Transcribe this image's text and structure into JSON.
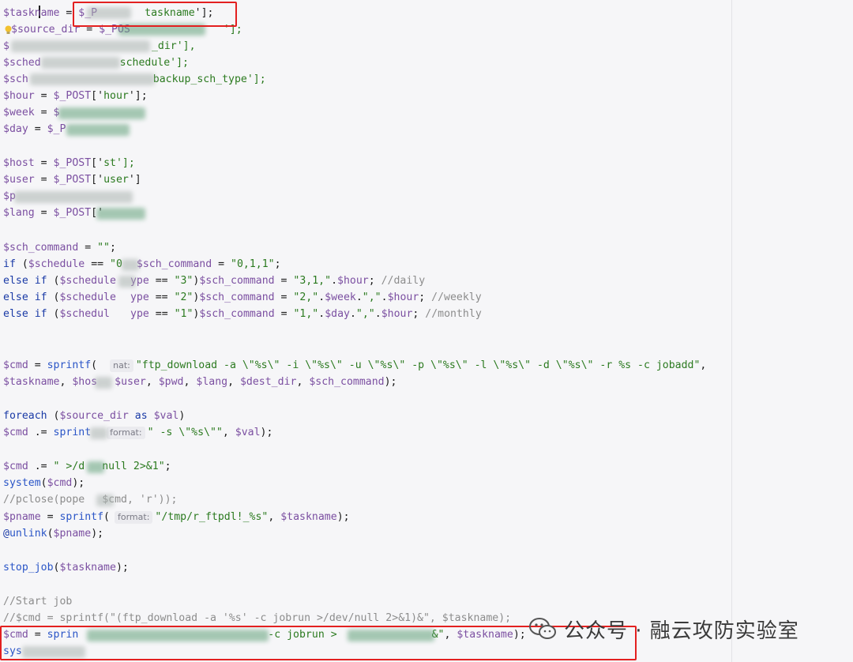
{
  "code": {
    "l1": [
      "$taskname",
      " = ",
      "$_P",
      "taskname",
      "'];"
    ],
    "l2": [
      "$source_dir",
      " = ",
      "$_POS",
      "'];"
    ],
    "l3": [
      "$",
      "_dir'],"
    ],
    "l4": [
      "$sched",
      "schedule'];"
    ],
    "l5": [
      "$sch",
      "backup_sch_type'];"
    ],
    "l6": [
      "$hour",
      " = ",
      "$_POST",
      "['",
      "hour",
      "'];"
    ],
    "l7": [
      "$week",
      " = ",
      "$"
    ],
    "l8": [
      "$day",
      " = ",
      "$_P"
    ],
    "l9": [
      "$host",
      " = ",
      "$_POST",
      "['",
      "st'];"
    ],
    "l10": [
      "$user",
      " = ",
      "$_POST",
      "['",
      "user",
      "']"
    ],
    "l11": [
      "$p"
    ],
    "l12": [
      "$lang",
      " = ",
      "$_POST",
      "['"
    ],
    "l13": [
      "$sch_command",
      " = ",
      "\"\"",
      ";"
    ],
    "l14": [
      "if",
      " (",
      "$schedule",
      " == ",
      "\"0",
      "$sch_command",
      " = ",
      "\"0,1,1\"",
      ";"
    ],
    "l15": [
      "else if",
      " (",
      "$schedule",
      "ype",
      " == ",
      "\"3\"",
      ")",
      "$sch_command",
      " = ",
      "\"3,1,\"",
      ".",
      "$hour",
      "; ",
      "//daily"
    ],
    "l16": [
      "else if",
      " (",
      "$schedule",
      "ype",
      " == ",
      "\"2\"",
      ")",
      "$sch_command",
      " = ",
      "\"2,\"",
      ".",
      "$week",
      ".",
      "\",\"",
      ".",
      "$hour",
      "; ",
      "//weekly"
    ],
    "l17": [
      "else if",
      " (",
      "$schedul",
      "ype",
      " == ",
      "\"1\"",
      ")",
      "$sch_command",
      " = ",
      "\"1,\"",
      ".",
      "$day",
      ".",
      "\",\"",
      ".",
      "$hour",
      "; ",
      "//monthly"
    ],
    "l18": [
      "$cmd",
      " = ",
      "sprintf",
      "(",
      "nat:",
      "\"ftp_download -a \\\"%s\\\" -i \\\"%s\\\" -u \\\"%s\\\" -p \\\"%s\\\" -l \\\"%s\\\" -d \\\"%s\\\" -r %s -c jobadd\"",
      ","
    ],
    "l19": [
      "$taskname",
      ", ",
      "$hos",
      "$user",
      ", ",
      "$pwd",
      ", ",
      "$lang",
      ", ",
      "$dest_dir",
      ", ",
      "$sch_command",
      ");"
    ],
    "l20": [
      "foreach",
      " (",
      "$source_dir",
      " as ",
      "$val",
      ")"
    ],
    "l21": [
      "$cmd",
      " .= ",
      "sprint",
      "format:",
      "\" -s \\\"%s\\\"\"",
      ", ",
      "$val",
      ");"
    ],
    "l22": [
      "$cmd",
      " .= ",
      "\" >/d",
      "null 2>&1\"",
      ";"
    ],
    "l23": [
      "system",
      "(",
      "$cmd",
      ");"
    ],
    "l24": [
      "//pclose(pope",
      "$cmd, 'r'));"
    ],
    "l25": [
      "$pname",
      " = ",
      "sprintf",
      "(",
      "format:",
      "\"/tmp/r_ftpdl!_%s\"",
      ", ",
      "$taskname",
      ");"
    ],
    "l26": [
      "@",
      "unlink",
      "(",
      "$pname",
      ");"
    ],
    "l27": [
      "stop_job",
      "(",
      "$taskname",
      ");"
    ],
    "l28": [
      "//Start job"
    ],
    "l29": [
      "//$cmd = sprintf(\"(ftp_download -a '%s' -c jobrun >/dev/null 2>&1)&\", $taskname);"
    ],
    "l30": [
      "$cmd",
      " = ",
      "sprin",
      "-c jobrun >",
      " &\"",
      ", ",
      "$taskname",
      ");"
    ],
    "l31": [
      "sys"
    ]
  },
  "watermark": {
    "text": "公众号 · 融云攻防实验室"
  },
  "colors": {
    "variable": "#7b4fa1",
    "string": "#2b7a1f",
    "function": "#2a55c7",
    "keyword": "#1a3aa6",
    "comment": "#8c8c8c",
    "highlight_box": "#e32020",
    "background": "#f6f6f8"
  },
  "icons": [
    "lightbulb-icon",
    "wechat-logo-icon"
  ]
}
